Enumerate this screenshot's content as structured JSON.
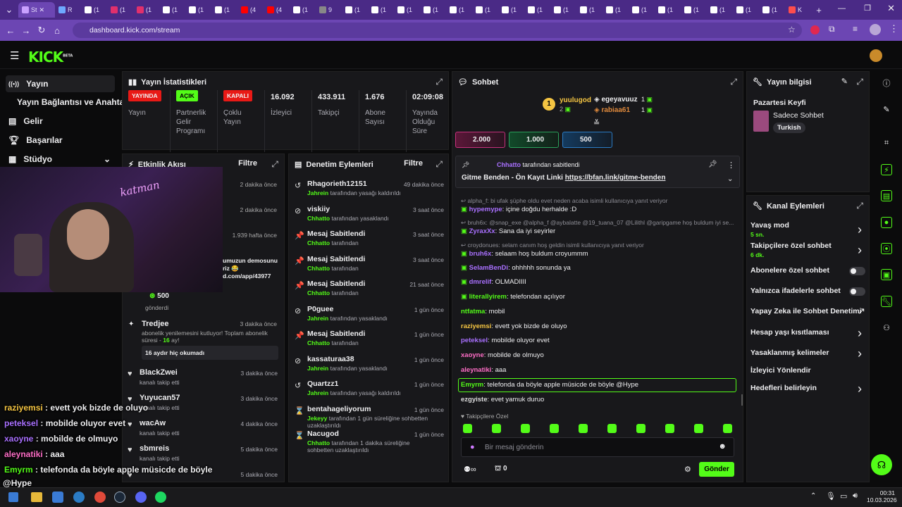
{
  "browser": {
    "tabs": [
      {
        "label": "St",
        "fav": "#c9a0ff"
      },
      {
        "label": "R",
        "fav": "#6ea8ff"
      },
      {
        "label": "(1",
        "fav": "#fff"
      },
      {
        "label": "(1",
        "fav": "#e1306c"
      },
      {
        "label": "(1",
        "fav": "#e1306c"
      },
      {
        "label": "(1",
        "fav": "#fff"
      },
      {
        "label": "(1",
        "fav": "#fff"
      },
      {
        "label": "(1",
        "fav": "#fff"
      },
      {
        "label": "(4",
        "fav": "#ff0000"
      },
      {
        "label": "(4",
        "fav": "#ff0000"
      },
      {
        "label": "(1",
        "fav": "#fff"
      },
      {
        "label": "9",
        "fav": "#888"
      },
      {
        "label": "(1",
        "fav": "#fff"
      },
      {
        "label": "(1",
        "fav": "#fff"
      },
      {
        "label": "(1",
        "fav": "#fff"
      },
      {
        "label": "(1",
        "fav": "#fff"
      },
      {
        "label": "(1",
        "fav": "#fff"
      },
      {
        "label": "(1",
        "fav": "#fff"
      },
      {
        "label": "(1",
        "fav": "#fff"
      },
      {
        "label": "(1",
        "fav": "#fff"
      },
      {
        "label": "(1",
        "fav": "#fff"
      },
      {
        "label": "(1",
        "fav": "#fff"
      },
      {
        "label": "(1",
        "fav": "#fff"
      },
      {
        "label": "(1",
        "fav": "#fff"
      },
      {
        "label": "(1",
        "fav": "#fff"
      },
      {
        "label": "(1",
        "fav": "#fff"
      },
      {
        "label": "(1",
        "fav": "#fff"
      },
      {
        "label": "(1",
        "fav": "#fff"
      },
      {
        "label": "(1",
        "fav": "#fff"
      },
      {
        "label": "K",
        "fav": "#ff4d4d"
      }
    ],
    "url": "dashboard.kick.com/stream"
  },
  "brand": {
    "logo": "KICK",
    "beta": "BETA"
  },
  "sidebar": {
    "items": [
      {
        "label": "Yayın",
        "icon": "broadcast-icon"
      },
      {
        "label": "Yayın Bağlantısı ve Anahtarı"
      },
      {
        "label": "Gelir",
        "icon": "dollar-icon"
      },
      {
        "label": "Başarılar",
        "icon": "trophy-icon"
      },
      {
        "label": "Stüdyo",
        "icon": "studio-icon"
      }
    ]
  },
  "stats": {
    "title": "Yayın İstatistikleri",
    "badges": [
      {
        "label": "YAYINDA",
        "color": "#e91916",
        "desc": "Yayın"
      },
      {
        "label": "AÇIK",
        "color": "#53fc18",
        "desc": "Partnerlik Gelir Programı"
      },
      {
        "label": "KAPALI",
        "color": "#e91916",
        "desc": "Çoklu Yayın"
      }
    ],
    "values": [
      {
        "v": "16.092",
        "l": "İzleyici"
      },
      {
        "v": "433.911",
        "l": "Takipçi"
      },
      {
        "v": "1.676",
        "l": "Abone Sayısı"
      },
      {
        "v": "02:09:08",
        "l": "Yayında Olduğu Süre"
      }
    ]
  },
  "activity": {
    "title": "Etkinlik Akışı",
    "filter": "Filtre",
    "top": [
      {
        "time": "2 dakika önce"
      },
      {
        "time": "2 dakika önce"
      },
      {
        "time": "1.939 hafta önce"
      }
    ],
    "snippet": [
      "umuzun demosunu",
      "riz 😂",
      "d.com/app/43977"
    ],
    "gift": {
      "value": "500",
      "label": "gönderdi"
    },
    "resub": {
      "name": "Tredjee",
      "time": "3 dakika önce",
      "text": "abonelik yenilemesini kutluyor! Toplam abonelik süresi -",
      "months": "16",
      "suffix": "ay!",
      "message": "16 aydır hiç okumadı"
    },
    "rows": [
      {
        "name": "BlackZwei",
        "sub": "kanalı takip etti",
        "time": "3 dakika önce"
      },
      {
        "name": "Yuyucan57",
        "sub": "kanalı takip etti",
        "time": "3 dakika önce"
      },
      {
        "name": "wacAw",
        "sub": "kanalı takip etti",
        "time": "4 dakika önce"
      },
      {
        "name": "sbmreis",
        "sub": "kanalı takip etti",
        "time": "5 dakika önce"
      },
      {
        "name": "",
        "sub": "",
        "time": "5 dakika önce"
      }
    ]
  },
  "moderation": {
    "title": "Denetim Eylemleri",
    "filter": "Filtre",
    "rows": [
      {
        "icon": "↺",
        "name": "Rhagorieth12151",
        "who": "Jahrein",
        "act": "tarafından yasağı kaldırıldı",
        "time": "49 dakika önce"
      },
      {
        "icon": "⊘",
        "name": "viskiiy",
        "who": "Chhatto",
        "act": "tarafından yasaklandı",
        "time": "3 saat önce"
      },
      {
        "icon": "📌",
        "name": "Mesaj Sabitlendi",
        "who": "Chhatto",
        "act": "tarafından",
        "time": "3 saat önce"
      },
      {
        "icon": "📌",
        "name": "Mesaj Sabitlendi",
        "who": "Chhatto",
        "act": "tarafından",
        "time": "3 saat önce"
      },
      {
        "icon": "📌",
        "name": "Mesaj Sabitlendi",
        "who": "Chhatto",
        "act": "tarafından",
        "time": "21 saat önce"
      },
      {
        "icon": "⊘",
        "name": "P0guee",
        "who": "Jahrein",
        "act": "tarafından yasaklandı",
        "time": "1 gün önce"
      },
      {
        "icon": "📌",
        "name": "Mesaj Sabitlendi",
        "who": "Chhatto",
        "act": "tarafından",
        "time": "1 gün önce"
      },
      {
        "icon": "⊘",
        "name": "kassaturaa38",
        "who": "Jahrein",
        "act": "tarafından yasaklandı",
        "time": "1 gün önce"
      },
      {
        "icon": "↺",
        "name": "Quartzz1",
        "who": "Jahrein",
        "act": "tarafından yasağı kaldırıldı",
        "time": "1 gün önce"
      },
      {
        "icon": "⌛",
        "name": "bentahageliyorum",
        "who": "Jekeyy",
        "act": "tarafından 1 gün süreliğine sohbetten uzaklaştırıldı",
        "time": "1 gün önce"
      },
      {
        "icon": "⌛",
        "name": "Nacugod",
        "who": "Chhatto",
        "act": "tarafından 1 dakika süreliğine sohbetten uzaklaştırıldı",
        "time": "1 gün önce"
      }
    ]
  },
  "chat": {
    "title": "Sohbet",
    "top": {
      "first": "yuulugod",
      "first_count": "2",
      "second": "egeyavuuz",
      "second_count": "1",
      "third": "rabiaa61",
      "third_count": "1"
    },
    "goals": [
      "2.000",
      "1.000",
      "500"
    ],
    "pinned": {
      "by": "Chhatto",
      "by_suffix": "tarafından sabitlendi",
      "text": "Gitme Benden - Ön Kayıt Linki",
      "link": "https://bfan.link/gitme-benden"
    },
    "messages": [
      {
        "sys": "alpha_f: bi ufak şüphe oldu evet neden acaba isimli kullanıcıya yanıt veriyor"
      },
      {
        "name": "hypemype",
        "color": "#a970ff",
        "text": "içine doğdu herhalde :D"
      },
      {
        "sys": "bruh6x: @snap_exe @alpha_f @aybalatte @19_tuana_07 @Lilithl @garipgame hoş buldum iyi se..."
      },
      {
        "name": "ZyraxXx",
        "color": "#a970ff",
        "text": "Sana da iyi seyirler"
      },
      {
        "sys": "croydonues: selam canım hoş geldin isimli kullanıcıya yanıt veriyor"
      },
      {
        "name": "bruh6x",
        "color": "#a970ff",
        "text": "selaam hoş buldum croyummm"
      },
      {
        "name": "SelamBenDi",
        "color": "#a970ff",
        "text": "ohhhhh sonunda ya"
      },
      {
        "name": "dmrelif",
        "color": "#a970ff",
        "text": "OLMADIIII"
      },
      {
        "name": "literallyirem",
        "color": "#53fc18",
        "text": "telefondan açılıyor"
      },
      {
        "name": "ntfatma",
        "color": "#53fc18",
        "text": "mobil"
      },
      {
        "name": "raziyemsi",
        "color": "#f5c542",
        "text": "evett yok bizde de oluyo"
      },
      {
        "name": "peteksel",
        "color": "#a970ff",
        "text": "mobilde oluyor evet"
      },
      {
        "name": "xaoyne",
        "color": "#ff6ec7",
        "text": "mobilde de olmuyo"
      },
      {
        "name": "aleynatiki",
        "color": "#ff6ec7",
        "text": "aaa"
      },
      {
        "name": "Emyrm",
        "color": "#53fc18",
        "text": "telefonda da böyle apple müsicde de böyle @Hype"
      },
      {
        "name": "ezgyiste",
        "color": "#dcdcdc",
        "text": "evet yamuk duruo"
      }
    ],
    "subs_only": "Takipçilere Özel",
    "placeholder": "Bir mesaj gönderin",
    "points": "0",
    "send": "Gönder"
  },
  "info": {
    "title": "Yayın bilgisi",
    "stream_title": "Pazartesi Keyfi",
    "category": "Sadece Sohbet",
    "tag": "Turkish"
  },
  "channel": {
    "title": "Kanal Eylemleri",
    "rows": [
      {
        "label": "Yavaş mod",
        "sub": "5 sn.",
        "control": "arrow"
      },
      {
        "label": "Takipçilere özel sohbet",
        "sub": "6 dk.",
        "control": "arrow"
      },
      {
        "label": "Abonelere özel sohbet",
        "control": "toggle"
      },
      {
        "label": "Yalnızca ifadelerle sohbet",
        "control": "toggle"
      },
      {
        "label": "Yapay Zeka ile Sohbet Denetimi",
        "control": "external"
      },
      {
        "label": "Hesap yaşı kısıtlaması",
        "control": "arrow"
      },
      {
        "label": "Yasaklanmış kelimeler",
        "control": "arrow"
      },
      {
        "label": "İzleyici Yönlendir",
        "control": "none"
      },
      {
        "label": "Hedefleri belirleyin",
        "control": "arrow"
      }
    ]
  },
  "overlay_chat": [
    {
      "name": "raziyemsi",
      "color": "#f5c542",
      "text": "evett yok bizde de oluyo"
    },
    {
      "name": "peteksel",
      "color": "#a970ff",
      "text": "mobilde oluyor evet"
    },
    {
      "name": "xaoyne",
      "color": "#a970ff",
      "text": "mobilde de olmuyo"
    },
    {
      "name": "aleynatiki",
      "color": "#ff6ec7",
      "text": "aaa"
    },
    {
      "name": "Emyrm",
      "color": "#53fc18",
      "text": "telefonda da böyle apple müsicde de böyle"
    },
    {
      "name": "",
      "color": "#fff",
      "text": "@Hype"
    },
    {
      "name": "ezgyiste",
      "color": "#dcdcdc",
      "text": "evet yamuk duruo"
    }
  ],
  "webcam_text": "katman",
  "taskbar": {
    "time": "00:31",
    "date": "10.03.2026"
  }
}
